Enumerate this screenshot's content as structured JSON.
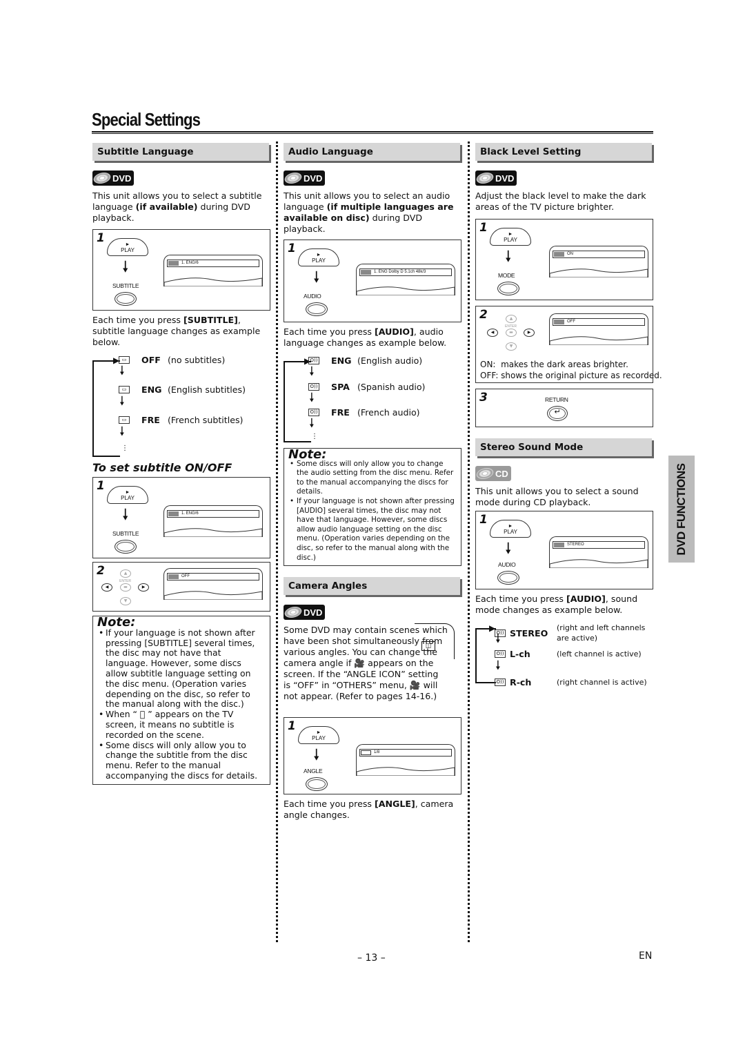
{
  "page": {
    "title": "Special Settings",
    "side_tab": "DVD FUNCTIONS",
    "page_number": "– 13 –",
    "language": "EN"
  },
  "subtitle_language": {
    "heading": "Subtitle Language",
    "badge": "DVD",
    "intro_1": "This unit allows you to select a subtitle language ",
    "intro_bold": "(if available)",
    "intro_2": " during DVD playback.",
    "step1": {
      "num": "1",
      "play": "PLAY",
      "button": "SUBTITLE",
      "screen": "1. ENG/6"
    },
    "after_1": "Each time you press ",
    "after_bold": "[SUBTITLE]",
    "after_2": ", subtitle language changes as example below.",
    "cycle": [
      {
        "code": "OFF",
        "desc": "(no subtitles)"
      },
      {
        "code": "ENG",
        "desc": "(English subtitles)"
      },
      {
        "code": "FRE",
        "desc": "(French subtitles)"
      }
    ],
    "onoff_heading": "To set subtitle ON/OFF",
    "onoff_step1": {
      "num": "1",
      "play": "PLAY",
      "button": "SUBTITLE",
      "screen": "1. ENG/6"
    },
    "onoff_step2": {
      "num": "2",
      "enter": "ENTER",
      "screen": "OFF"
    },
    "note": {
      "title": "Note:",
      "items": [
        "If your language is not shown after pressing [SUBTITLE] several times, the disc may not have that language. However, some discs allow subtitle language setting on the disc menu. (Operation varies depending on the disc, so refer to the manual along with the disc.)",
        "When “ ⃠ ” appears on the TV screen, it means no subtitle is recorded on the scene.",
        "Some discs will only allow you to change the subtitle from the disc menu. Refer to the manual accompanying the discs for details."
      ]
    }
  },
  "audio_language": {
    "heading": "Audio Language",
    "badge": "DVD",
    "intro_1": "This unit allows you to select an audio language ",
    "intro_bold": "(if multiple languages are available on disc)",
    "intro_2": " during DVD playback.",
    "step1": {
      "num": "1",
      "play": "PLAY",
      "button": "AUDIO",
      "screen": "1. ENG Dolby D 5.1ch 48k/3"
    },
    "after_1": "Each time you press ",
    "after_bold": "[AUDIO]",
    "after_2": ", audio language changes as example below.",
    "cycle": [
      {
        "code": "ENG",
        "desc": "(English audio)"
      },
      {
        "code": "SPA",
        "desc": "(Spanish audio)"
      },
      {
        "code": "FRE",
        "desc": "(French audio)"
      }
    ],
    "note": {
      "title": "Note:",
      "items": [
        "Some discs will only allow you to change the audio setting from the disc menu. Refer to the manual accompanying the discs for details.",
        "If your language is not shown after pressing [AUDIO] several times, the disc may not have that language. However, some discs allow audio language setting on the disc menu. (Operation varies depending on the disc, so refer to the manual along with the disc.)"
      ]
    }
  },
  "camera_angles": {
    "heading": "Camera Angles",
    "badge": "DVD",
    "intro": "Some DVD may contain scenes which have been shot simultaneously from various angles. You can change the camera angle if 🎥 appears on the screen. If the “ANGLE ICON” setting is “OFF” in “OTHERS” menu, 🎥 will not appear. (Refer to pages 14-16.)",
    "step1": {
      "num": "1",
      "play": "PLAY",
      "button": "ANGLE",
      "screen": "1/8"
    },
    "after_1": "Each time you press ",
    "after_bold": "[ANGLE]",
    "after_2": ", camera angle changes."
  },
  "black_level": {
    "heading": "Black Level Setting",
    "badge": "DVD",
    "intro": "Adjust the black level to make the dark areas of the TV picture brighter.",
    "step1": {
      "num": "1",
      "play": "PLAY",
      "button": "MODE",
      "screen": "ON"
    },
    "step2": {
      "num": "2",
      "enter": "ENTER",
      "screen": "OFF",
      "on_desc": "ON:  makes the dark areas brighter.",
      "off_desc": "OFF: shows the original picture as recorded."
    },
    "step3": {
      "num": "3",
      "button": "RETURN"
    }
  },
  "stereo_sound": {
    "heading": "Stereo Sound Mode",
    "badge": "CD",
    "intro": "This unit allows you to select a sound mode during CD playback.",
    "step1": {
      "num": "1",
      "play": "PLAY",
      "button": "AUDIO",
      "screen": "STEREO"
    },
    "after_1": "Each time you press ",
    "after_bold": "[AUDIO]",
    "after_2": ", sound mode changes as example below.",
    "cycle": [
      {
        "code": "STEREO",
        "desc": "(right and left channels are active)"
      },
      {
        "code": "L-ch",
        "desc": "(left channel is active)"
      },
      {
        "code": "R-ch",
        "desc": "(right channel is active)"
      }
    ]
  }
}
